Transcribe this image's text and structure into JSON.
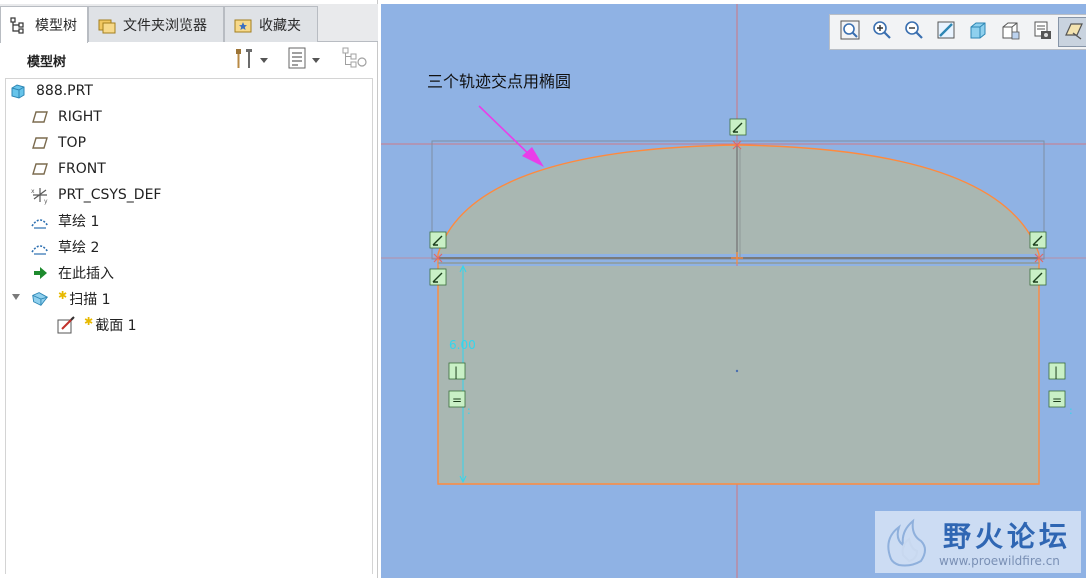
{
  "tabs": [
    {
      "label": "模型树",
      "icon": "model-tree-icon",
      "active": true
    },
    {
      "label": "文件夹浏览器",
      "icon": "folder-browser-icon",
      "active": false
    },
    {
      "label": "收藏夹",
      "icon": "favorites-icon",
      "active": false
    }
  ],
  "tree_header": {
    "title": "模型树",
    "buttons": [
      "settings-tools-icon",
      "show-list-icon",
      "filter-tree-icon"
    ]
  },
  "tree": [
    {
      "label": "888.PRT",
      "icon": "part-icon"
    },
    {
      "label": "RIGHT",
      "icon": "datum-plane-icon"
    },
    {
      "label": "TOP",
      "icon": "datum-plane-icon"
    },
    {
      "label": "FRONT",
      "icon": "datum-plane-icon"
    },
    {
      "label": "PRT_CSYS_DEF",
      "icon": "coordinate-system-icon"
    },
    {
      "label": "草绘 1",
      "icon": "sketch-icon"
    },
    {
      "label": "草绘 2",
      "icon": "sketch-icon"
    },
    {
      "label": "在此插入",
      "icon": "insert-here-arrow-icon"
    },
    {
      "label": "扫描 1",
      "icon": "sweep-feature-icon",
      "new": true,
      "expanded": true
    },
    {
      "label": "截面 1",
      "icon": "section-sketch-icon",
      "new": true
    }
  ],
  "view_toolbar": [
    "refit-icon",
    "zoom-in-icon",
    "zoom-out-icon",
    "repaint-icon",
    "display-style-icon",
    "saved-orientations-icon",
    "view-manager-icon",
    "sketch-view-icon"
  ],
  "graphics": {
    "annotation": "三个轨迹交点用椭圆",
    "dimension_value": "6.00",
    "constraint_labels": [
      "|",
      "=",
      "|",
      "="
    ],
    "colors": {
      "background": "#8fb2e4",
      "section_fill": "#a9b7b2",
      "outline": "#ff8a3d",
      "reference_line": "#e06868",
      "dimension": "#33d6ee",
      "arrow": "#e93ee9"
    }
  },
  "watermark": {
    "title": "野火论坛",
    "url": "www.proewildfire.cn"
  }
}
